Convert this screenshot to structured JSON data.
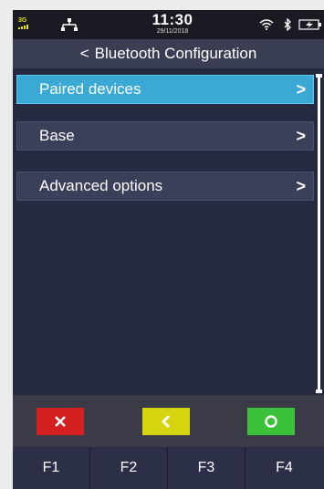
{
  "status": {
    "signal_text": "3G",
    "time": "11:30",
    "date": "29/11/2018"
  },
  "header": {
    "back_glyph": "<",
    "title": "Bluetooth Configuration"
  },
  "menu": {
    "items": [
      {
        "label": "Paired devices",
        "selected": true
      },
      {
        "label": "Base",
        "selected": false
      },
      {
        "label": "Advanced options",
        "selected": false
      }
    ],
    "chevron": ">"
  },
  "keys": {
    "cancel_icon": "close-icon",
    "back_icon": "chevron-left-icon",
    "ok_icon": "circle-icon",
    "cancel_color": "#d42020",
    "back_color": "#d6d30f",
    "ok_color": "#3cc23a"
  },
  "function_keys": [
    "F1",
    "F2",
    "F3",
    "F4"
  ],
  "colors": {
    "selected": "#3aa9d6",
    "background": "#262a40",
    "item": "#3a3f5a"
  }
}
